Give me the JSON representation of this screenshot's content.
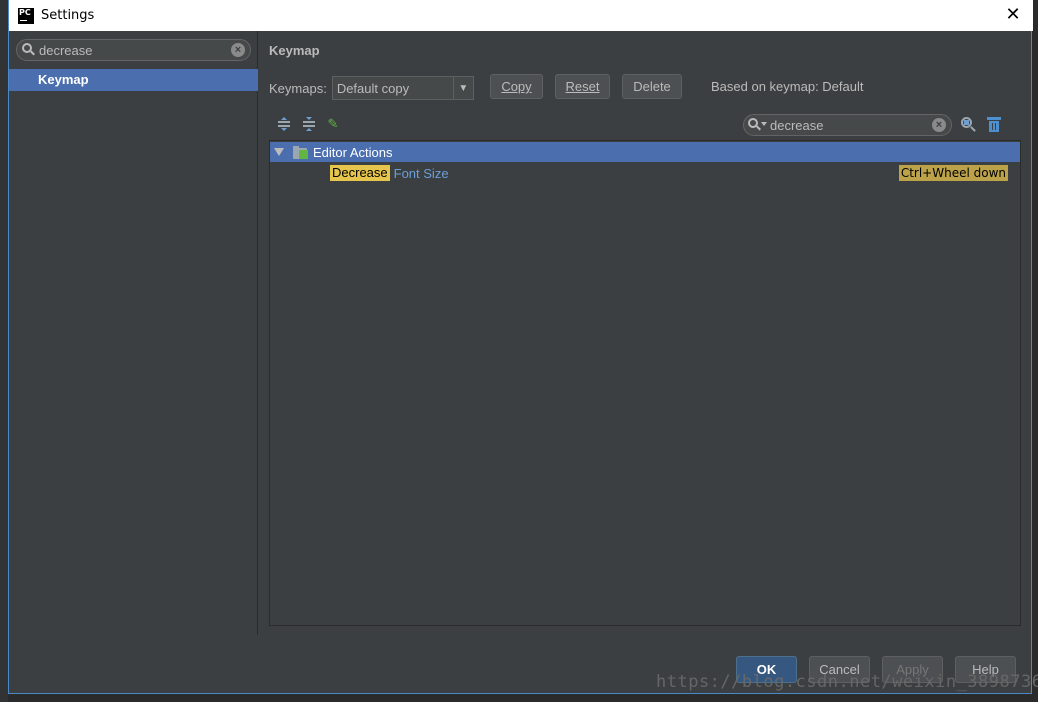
{
  "window": {
    "title": "Settings",
    "app_icon_text": "PC",
    "close_glyph": "✕"
  },
  "left": {
    "search_value": "decrease",
    "items": [
      {
        "label": "Keymap",
        "selected": true
      }
    ]
  },
  "keymap": {
    "section_title": "Keymap",
    "keymaps_label": "Keymaps:",
    "selected_keymap": "Default copy",
    "buttons": {
      "copy": "Copy",
      "reset": "Reset",
      "delete": "Delete"
    },
    "based_on": "Based on keymap: Default",
    "filter_value": "decrease",
    "tree": {
      "group": "Editor Actions",
      "action_highlight": "Decrease",
      "action_rest": "Font Size",
      "shortcut": "Ctrl+Wheel down"
    }
  },
  "footer": {
    "ok": "OK",
    "cancel": "Cancel",
    "apply": "Apply",
    "help": "Help"
  },
  "watermark": "https://blog.csdn.net/weixin_38987362",
  "colors": {
    "accent": "#4b6eaf",
    "highlight": "#e6c54c",
    "action_link": "#6a9fd8",
    "dialog_bg": "#3c3f41"
  },
  "icons": {
    "search": "search-icon",
    "clear": "clear-icon",
    "expand_all": "expand-all-icon",
    "collapse_all": "collapse-all-icon",
    "edit": "edit-icon",
    "find_shortcut": "find-by-shortcut-icon",
    "clear_filter": "trash-icon"
  }
}
